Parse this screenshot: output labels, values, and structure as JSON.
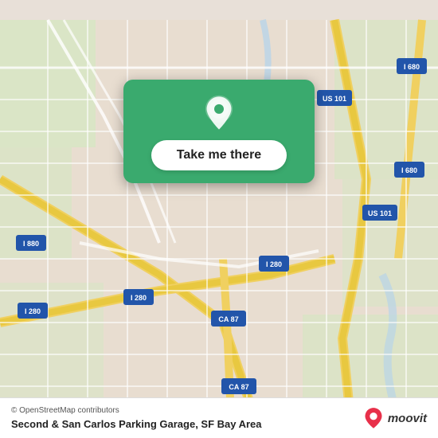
{
  "map": {
    "bg_color": "#e8e0d8",
    "attribution": "© OpenStreetMap contributors",
    "title": "Second & San Carlos Parking Garage, SF Bay Area"
  },
  "card": {
    "button_label": "Take me there",
    "pin_color": "#ffffff"
  },
  "moovit": {
    "label": "moovit"
  }
}
